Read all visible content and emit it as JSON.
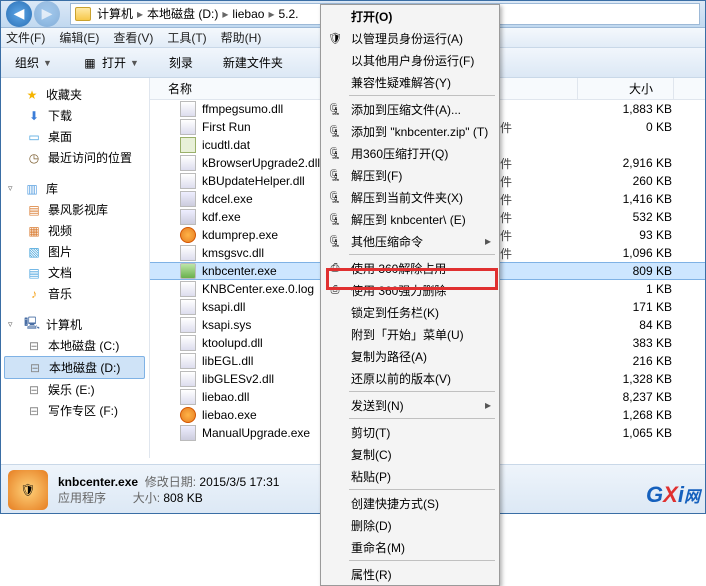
{
  "breadcrumb": {
    "p0": "计算机",
    "p1": "本地磁盘 (D:)",
    "p2": "liebao",
    "p3": "5.2."
  },
  "menubar": {
    "file": "文件(F)",
    "edit": "编辑(E)",
    "view": "查看(V)",
    "tools": "工具(T)",
    "help": "帮助(H)"
  },
  "toolbar": {
    "organize": "组织",
    "open": "打开",
    "burn": "刻录",
    "newfolder": "新建文件夹"
  },
  "columns": {
    "name": "名称",
    "size": "大小"
  },
  "sidebar": {
    "fav": "收藏夹",
    "dl": "下载",
    "desktop": "桌面",
    "recent": "最近访问的位置",
    "lib": "库",
    "bf": "暴风影视库",
    "video": "视频",
    "pic": "图片",
    "doc": "文档",
    "music": "音乐",
    "pc": "计算机",
    "c": "本地磁盘 (C:)",
    "d": "本地磁盘 (D:)",
    "e": "娱乐 (E:)",
    "f": "写作专区 (F:)"
  },
  "files": [
    {
      "n": "ffmpegsumo.dll",
      "t": "",
      "s": "1,883 KB",
      "i": "dll"
    },
    {
      "n": "First Run",
      "t": "文件",
      "s": "0 KB",
      "i": "dll"
    },
    {
      "n": "icudtl.dat",
      "t": "",
      "s": "",
      "i": "dat"
    },
    {
      "n": "kBrowserUpgrade2.dll",
      "t": "文件",
      "s": "2,916 KB",
      "i": "dll"
    },
    {
      "n": "kBUpdateHelper.dll",
      "t": "文件",
      "s": "260 KB",
      "i": "dll"
    },
    {
      "n": "kdcel.exe",
      "t": "文件",
      "s": "1,416 KB",
      "i": "exe"
    },
    {
      "n": "kdf.exe",
      "t": "文件",
      "s": "532 KB",
      "i": "exe"
    },
    {
      "n": "kdumprep.exe",
      "t": "文件",
      "s": "93 KB",
      "i": "orange"
    },
    {
      "n": "kmsgsvc.dll",
      "t": "文件",
      "s": "1,096 KB",
      "i": "dll"
    },
    {
      "n": "knbcenter.exe",
      "t": "序",
      "s": "809 KB",
      "i": "shield",
      "sel": true
    },
    {
      "n": "KNBCenter.exe.0.log",
      "t": "",
      "s": "1 KB",
      "i": "dll"
    },
    {
      "n": "ksapi.dll",
      "t": "",
      "s": "171 KB",
      "i": "dll"
    },
    {
      "n": "ksapi.sys",
      "t": "",
      "s": "84 KB",
      "i": "dll"
    },
    {
      "n": "ktoolupd.dll",
      "t": "",
      "s": "383 KB",
      "i": "dll"
    },
    {
      "n": "libEGL.dll",
      "t": "",
      "s": "216 KB",
      "i": "dll"
    },
    {
      "n": "libGLESv2.dll",
      "t": "",
      "s": "1,328 KB",
      "i": "dll"
    },
    {
      "n": "liebao.dll",
      "t": "",
      "s": "8,237 KB",
      "i": "dll"
    },
    {
      "n": "liebao.exe",
      "t": "",
      "s": "1,268 KB",
      "i": "orange"
    },
    {
      "n": "ManualUpgrade.exe",
      "t": "",
      "s": "1,065 KB",
      "i": "exe"
    }
  ],
  "context": {
    "open": "打开(O)",
    "runas": "以管理员身份运行(A)",
    "runasother": "以其他用户身份运行(F)",
    "compat": "兼容性疑难解答(Y)",
    "addzip": "添加到压缩文件(A)...",
    "addzipname": "添加到 \"knbcenter.zip\" (T)",
    "open360zip": "用360压缩打开(Q)",
    "extractto": "解压到(F)",
    "extracthere": "解压到当前文件夹(X)",
    "extractname": "解压到 knbcenter\\ (E)",
    "otherzip": "其他压缩命令",
    "unlock360": "使用 360解除占用",
    "forcedel360": "使用 360强力删除",
    "lockwork": "锁定到任务栏(K)",
    "pinstart": "附到「开始」菜单(U)",
    "copypath": "复制为路径(A)",
    "restorever": "还原以前的版本(V)",
    "sendto": "发送到(N)",
    "cut": "剪切(T)",
    "copy": "复制(C)",
    "paste": "粘贴(P)",
    "shortcut": "创建快捷方式(S)",
    "delete": "删除(D)",
    "rename": "重命名(M)",
    "props": "属性(R)"
  },
  "status": {
    "name": "knbcenter.exe",
    "type": "应用程序",
    "modlabel": "修改日期:",
    "moddate": "2015/3/5 17:31",
    "sizelabel": "大小:",
    "size": "808 KB"
  },
  "watermark": {
    "g": "G",
    "x": "X",
    "i": "i",
    "net": "网"
  }
}
